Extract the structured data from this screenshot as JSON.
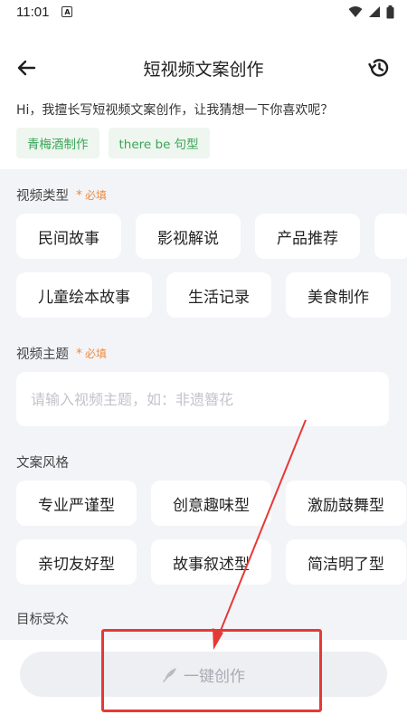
{
  "status_bar": {
    "time": "11:01",
    "notif": "A"
  },
  "header": {
    "title": "短视频文案创作"
  },
  "greeting": "Hi，我擅长写短视频文案创作，让我猜想一下你喜欢呢？",
  "suggestions": [
    "青梅酒制作",
    "there be 句型"
  ],
  "video_type": {
    "label": "视频类型",
    "required_star": "*",
    "required_text": "必填",
    "row1": [
      "民间故事",
      "影视解说",
      "产品推荐"
    ],
    "row2": [
      "儿童绘本故事",
      "生活记录",
      "美食制作"
    ]
  },
  "video_topic": {
    "label": "视频主题",
    "required_star": "*",
    "required_text": "必填",
    "placeholder": "请输入视频主题，如：非遗簪花"
  },
  "copy_style": {
    "label": "文案风格",
    "row1": [
      "专业严谨型",
      "创意趣味型",
      "激励鼓舞型"
    ],
    "row2": [
      "亲切友好型",
      "故事叙述型",
      "简洁明了型"
    ]
  },
  "audience": {
    "label": "目标受众"
  },
  "create_button": {
    "label": "一键创作"
  },
  "colors": {
    "accent_green": "#3aa558",
    "required_orange": "#f08a3c",
    "annotation_red": "#e53935"
  },
  "icons": {
    "back": "arrow-left-icon",
    "history": "history-icon",
    "create": "feather-icon"
  }
}
